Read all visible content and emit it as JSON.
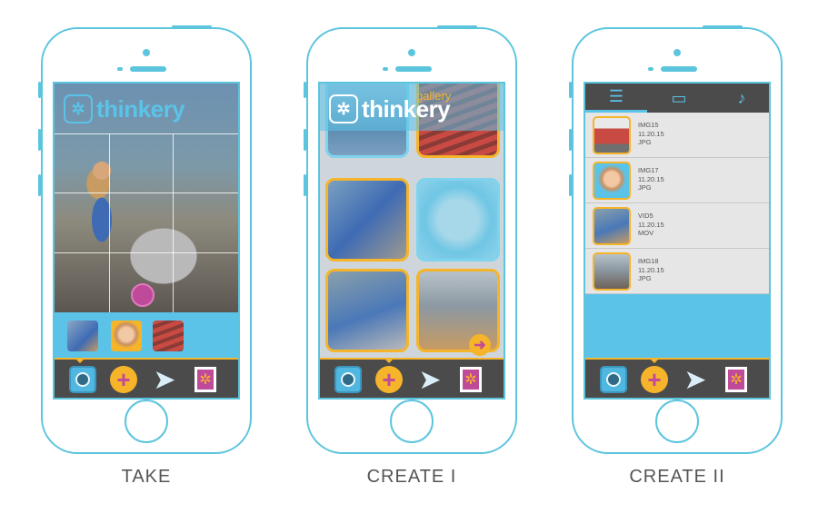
{
  "brand": {
    "name": "thinkery",
    "mark": "✲",
    "gallery_label": "gallery"
  },
  "captions": {
    "take": "TAKE",
    "create1": "CREATE I",
    "create2": "CREATE II"
  },
  "toolbar": {
    "camera": "camera-icon",
    "add": "+",
    "send": "➤",
    "stamp": "✲"
  },
  "create1": {
    "next_arrow": "➜"
  },
  "create2": {
    "tabs": [
      {
        "icon": "☰",
        "name": "list-view"
      },
      {
        "icon": "▭",
        "name": "single-view"
      },
      {
        "icon": "♪",
        "name": "music"
      }
    ],
    "items": [
      {
        "name": "IMG15",
        "date": "11.20.15",
        "type": "JPG"
      },
      {
        "name": "IMG17",
        "date": "11.20.15",
        "type": "JPG"
      },
      {
        "name": "VID5",
        "date": "11.20.15",
        "type": "MOV"
      },
      {
        "name": "IMG18",
        "date": "11.20.15",
        "type": "JPG"
      }
    ]
  },
  "colors": {
    "accent": "#5cc5de",
    "yellow": "#f5b42a",
    "magenta": "#c04a9a",
    "dark": "#4b4b4b"
  }
}
